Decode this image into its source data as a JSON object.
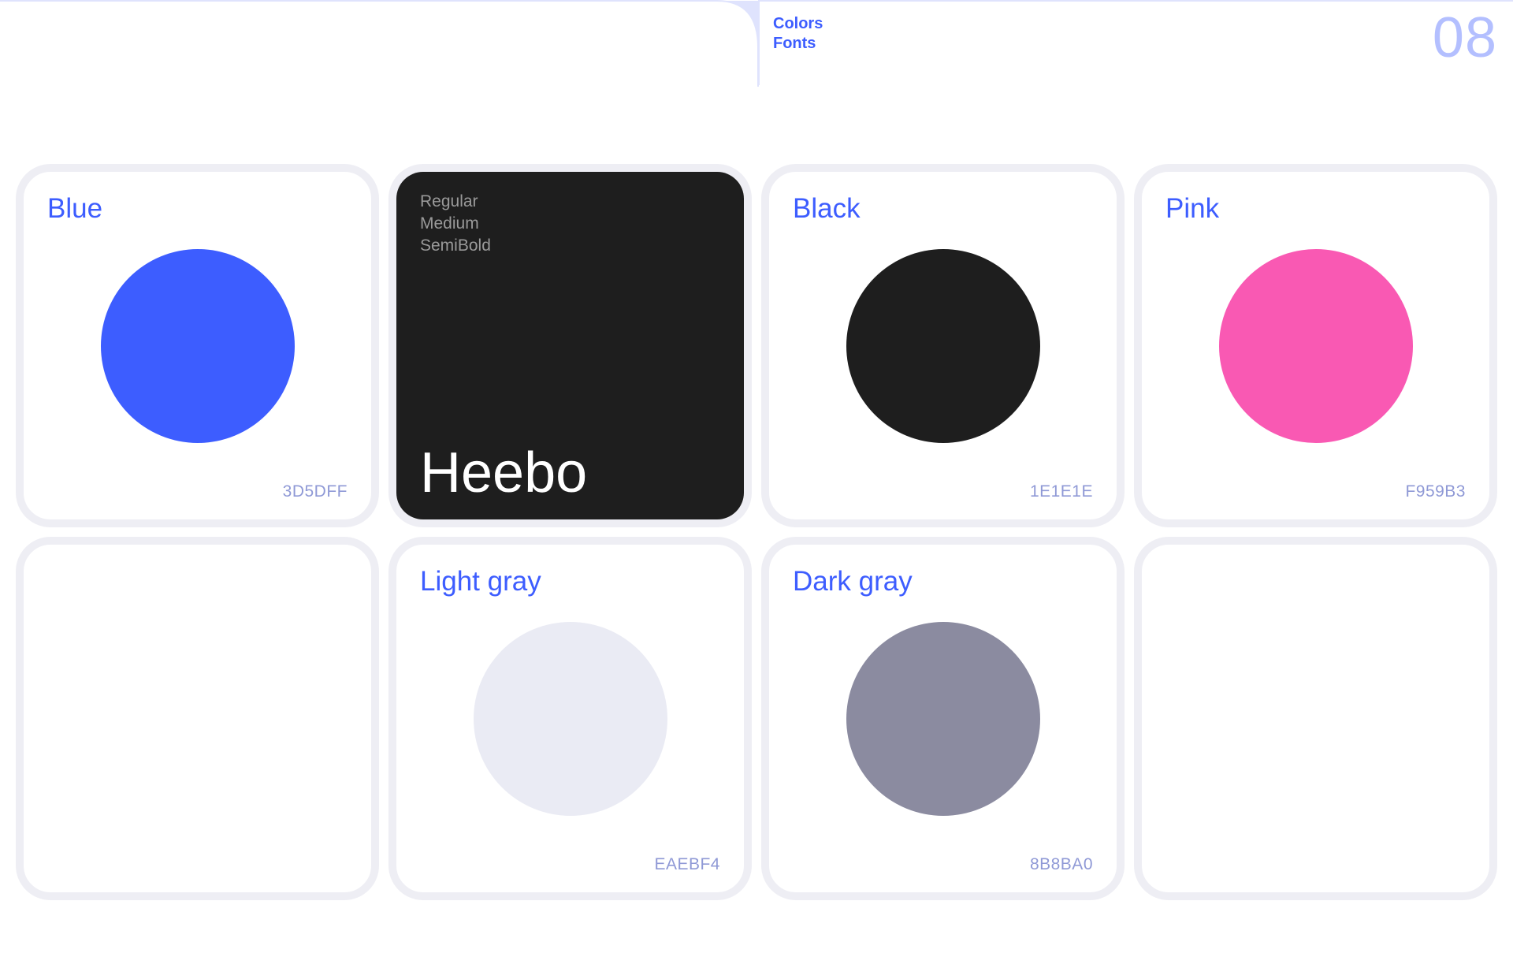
{
  "header": {
    "links": [
      "Colors",
      "Fonts"
    ],
    "page_number": "08"
  },
  "colors": {
    "blue": {
      "name": "Blue",
      "hex": "3D5DFF",
      "swatch": "#3D5DFF"
    },
    "black": {
      "name": "Black",
      "hex": "1E1E1E",
      "swatch": "#1E1E1E"
    },
    "pink": {
      "name": "Pink",
      "hex": "F959B3",
      "swatch": "#F959B3"
    },
    "light_gray": {
      "name": "Light gray",
      "hex": "EAEBF4",
      "swatch": "#EAEBF4"
    },
    "dark_gray": {
      "name": "Dark gray",
      "hex": "8B8BA0",
      "swatch": "#8B8BA0"
    }
  },
  "font": {
    "name": "Heebo",
    "weights": [
      "Regular",
      "Medium",
      "SemiBold"
    ]
  },
  "theme": {
    "accent": "#3D5DFF",
    "card_border": "#EEEEF4",
    "header_line": "#DFE3FD",
    "page_number_color": "#B3BFFF"
  }
}
